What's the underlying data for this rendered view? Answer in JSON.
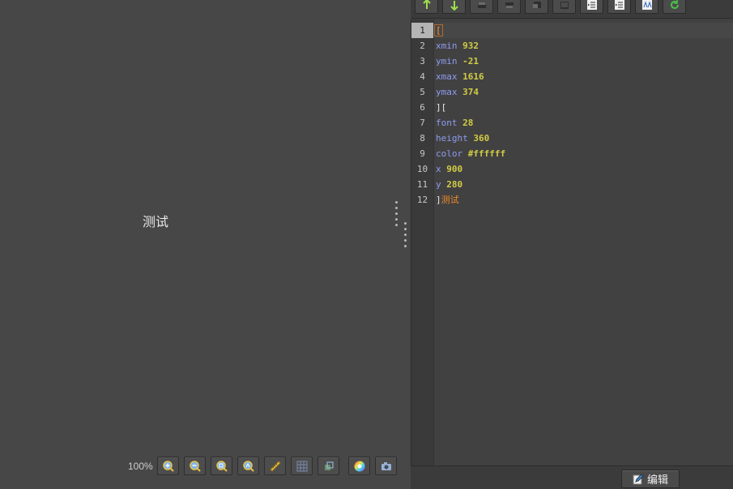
{
  "preview": {
    "text": "测试",
    "zoom_label": "100%",
    "toolbar_icons": [
      "zoom-in-icon",
      "zoom-out-icon",
      "zoom-fit-icon",
      "zoom-actual-icon",
      "ruler-icon",
      "grid-icon",
      "crop-icon",
      "color-wheel-icon",
      "camera-icon"
    ]
  },
  "editor_toolbar": {
    "icons": [
      "move-up-icon",
      "move-down-icon",
      "layer-1-icon",
      "layer-2-icon",
      "layer-3-icon",
      "layer-4-icon",
      "outdent-icon",
      "indent-icon",
      "text-style-icon",
      "refresh-icon"
    ]
  },
  "editor": {
    "line_numbers": [
      "1",
      "2",
      "3",
      "4",
      "5",
      "6",
      "7",
      "8",
      "9",
      "10",
      "11",
      "12"
    ],
    "lines": [
      {
        "key": "",
        "value": "",
        "bracket": "["
      },
      {
        "key": "xmin",
        "value": "932"
      },
      {
        "key": "ymin",
        "value": "-21"
      },
      {
        "key": "xmax",
        "value": "1616"
      },
      {
        "key": "ymax",
        "value": "374"
      },
      {
        "key": "",
        "value": "",
        "bracket": "]["
      },
      {
        "key": "font",
        "value": "28"
      },
      {
        "key": "height",
        "value": "360"
      },
      {
        "key": "color",
        "value": "#ffffff"
      },
      {
        "key": "x",
        "value": "900"
      },
      {
        "key": "y",
        "value": "280"
      },
      {
        "key": "",
        "value": "",
        "bracket": "]",
        "text": "测试"
      }
    ]
  },
  "status": {
    "edit_label": "编辑"
  },
  "colors": {
    "key": "#8f9bf0",
    "value": "#d2cc45",
    "text": "#f08a2a",
    "arrow": "#9ee04a"
  }
}
